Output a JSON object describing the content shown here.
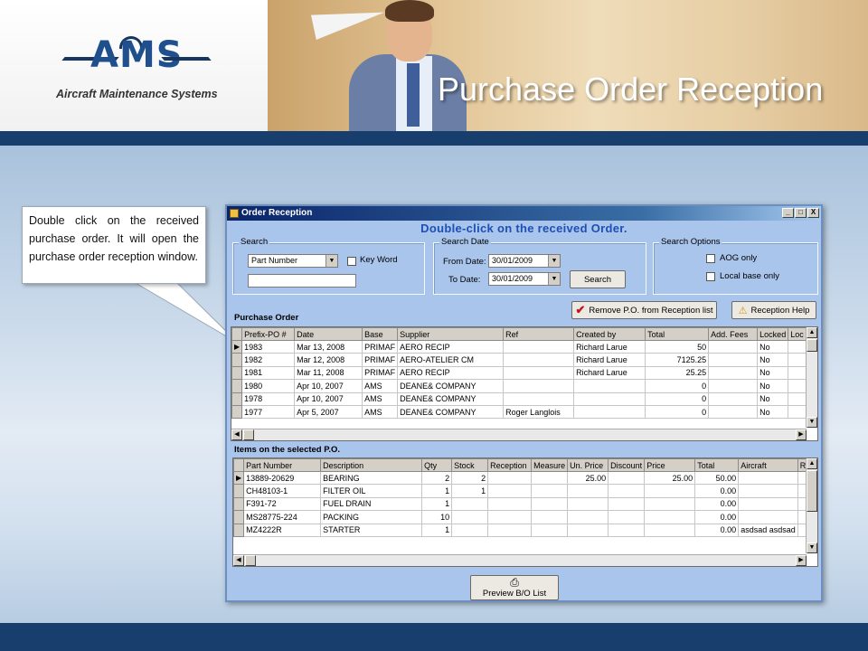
{
  "slide": {
    "title": "Purchase Order Reception",
    "logo_text": "AMS",
    "logo_subtitle": "Aircraft Maintenance Systems",
    "callout": "Double click on the received purchase order. It will open the purchase order reception window."
  },
  "window": {
    "title": "Order Reception",
    "controls": [
      "_",
      "□",
      "X"
    ],
    "hint": "Double-click on the received Order."
  },
  "search": {
    "label": "Search",
    "field_value": "Part Number",
    "keyword_label": "Key Word",
    "text_value": ""
  },
  "search_date": {
    "label": "Search Date",
    "from_label": "From Date:",
    "from_value": "30/01/2009",
    "to_label": "To Date:",
    "to_value": "30/01/2009",
    "button": "Search"
  },
  "search_options": {
    "label": "Search Options",
    "aog_label": "AOG only",
    "local_label": "Local base only"
  },
  "buttons": {
    "remove": "Remove P.O. from Reception list",
    "help": "Reception Help",
    "preview": "Preview B/O List"
  },
  "purchase_order": {
    "section_label": "Purchase Order",
    "columns": [
      "Prefix-PO #",
      "Date",
      "Base",
      "Supplier",
      "Ref",
      "Created by",
      "Total",
      "Add. Fees",
      "Locked",
      "Loc"
    ],
    "rows": [
      [
        "1983",
        "Mar 13, 2008",
        "PRIMAF",
        "AERO RECIP",
        "",
        "Richard Larue",
        "50",
        "",
        "No",
        ""
      ],
      [
        "1982",
        "Mar 12, 2008",
        "PRIMAF",
        "AERO-ATELIER CM",
        "",
        "Richard Larue",
        "7125.25",
        "",
        "No",
        ""
      ],
      [
        "1981",
        "Mar 11, 2008",
        "PRIMAF",
        "AERO RECIP",
        "",
        "Richard Larue",
        "25.25",
        "",
        "No",
        ""
      ],
      [
        "1980",
        "Apr 10, 2007",
        "AMS",
        "DEANE& COMPANY",
        "",
        "",
        "0",
        "",
        "No",
        ""
      ],
      [
        "1978",
        "Apr 10, 2007",
        "AMS",
        "DEANE& COMPANY",
        "",
        "",
        "0",
        "",
        "No",
        ""
      ],
      [
        "1977",
        "Apr 5, 2007",
        "AMS",
        "DEANE& COMPANY",
        "Roger Langlois",
        "",
        "0",
        "",
        "No",
        ""
      ]
    ]
  },
  "items": {
    "section_label": "Items on the selected P.O.",
    "columns": [
      "Part Number",
      "Description",
      "Qty",
      "Stock",
      "Reception",
      "Measure",
      "Un. Price",
      "Discount",
      "Price",
      "Total",
      "Aircraft",
      "Re"
    ],
    "rows": [
      [
        "13889-20629",
        "BEARING",
        "2",
        "2",
        "",
        "",
        "25.00",
        "",
        "25.00",
        "50.00",
        "",
        ""
      ],
      [
        "CH48103-1",
        "FILTER OIL",
        "1",
        "1",
        "",
        "",
        "",
        "",
        "",
        "0.00",
        "",
        ""
      ],
      [
        "F391-72",
        "FUEL DRAIN",
        "1",
        "",
        "",
        "",
        "",
        "",
        "",
        "0.00",
        "",
        ""
      ],
      [
        "MS28775-224",
        "PACKING",
        "10",
        "",
        "",
        "",
        "",
        "",
        "",
        "0.00",
        "",
        ""
      ],
      [
        "MZ4222R",
        "STARTER",
        "1",
        "",
        "",
        "",
        "",
        "",
        "",
        "0.00",
        "asdsad asdsad",
        ""
      ]
    ]
  },
  "colors": {
    "window_bg": "#a9c5ec",
    "hint_text": "#1d4fb5",
    "slide_bar": "#173e6c"
  }
}
